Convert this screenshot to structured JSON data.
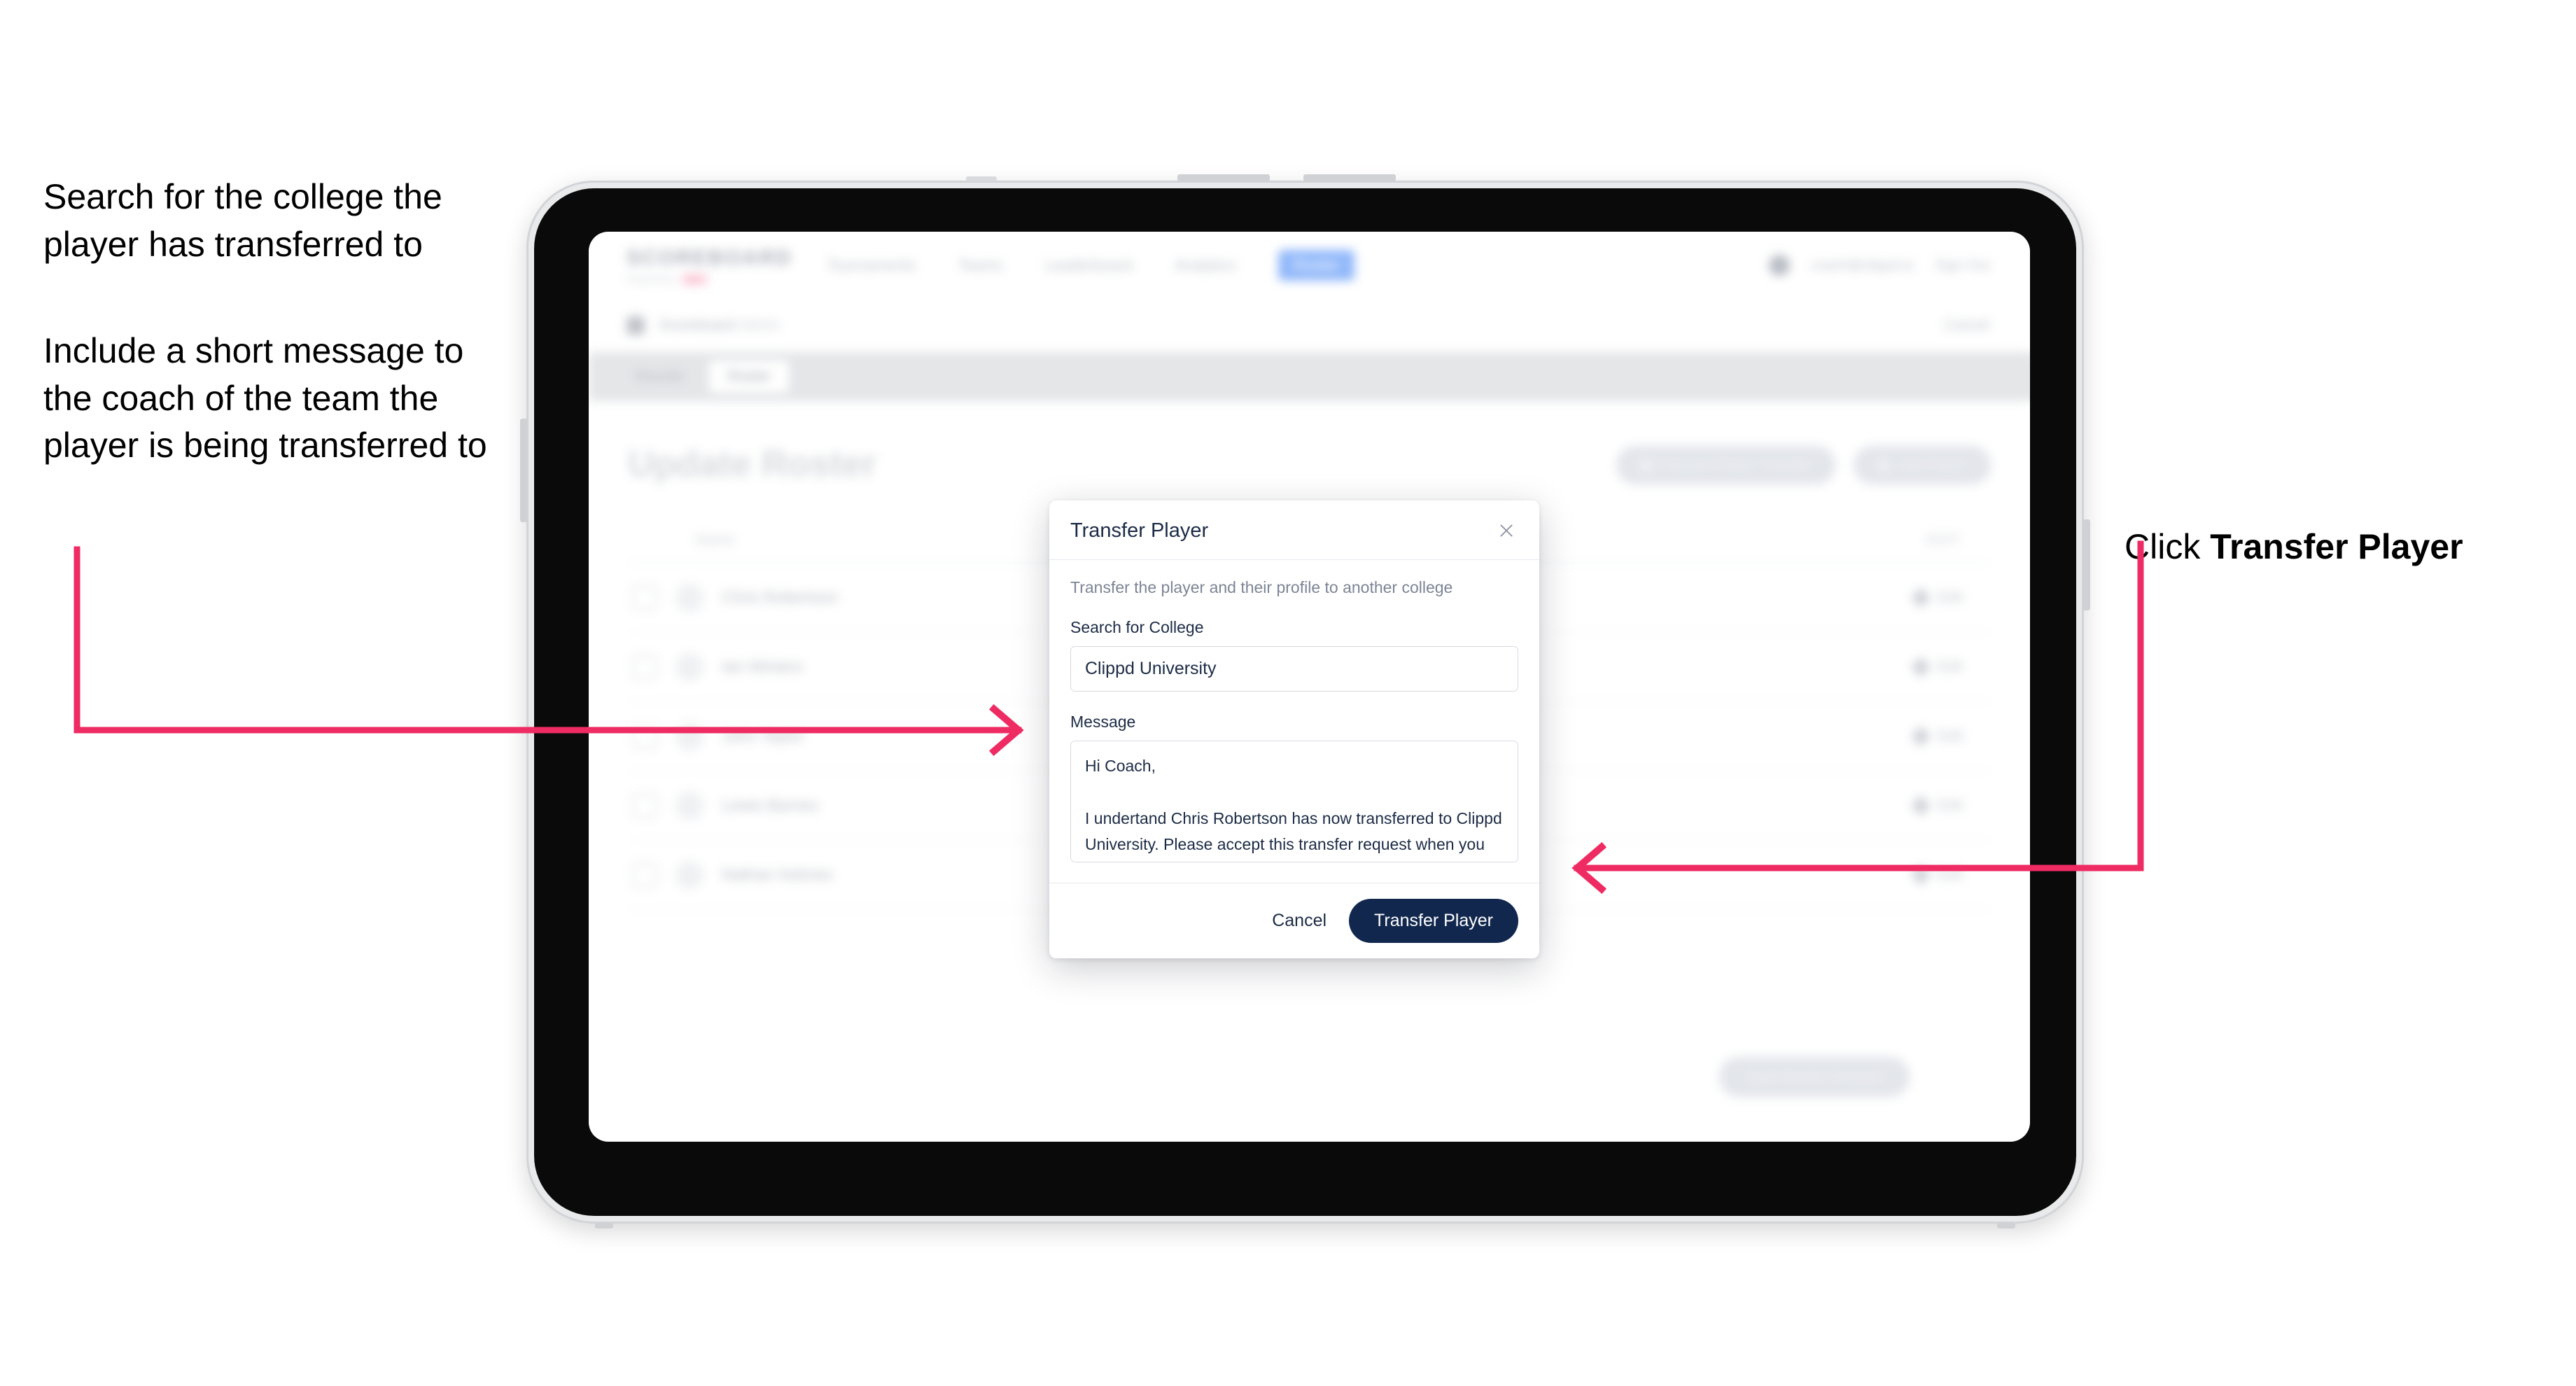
{
  "annotations": {
    "left_note_1": "Search for the college the player has transferred to",
    "left_note_2": "Include a short message to the coach of the team the player is being transferred to",
    "right_note_prefix": "Click ",
    "right_note_bold": "Transfer Player"
  },
  "colors": {
    "arrow": "#ee2b62",
    "primary_button": "#11274d",
    "modal_title": "#1c2b45",
    "nav_pill": "#4f8ef7"
  },
  "app": {
    "logo": "SCOREBOARD",
    "logo_sub": "Powered by",
    "logo_badge": "beta",
    "nav_links": [
      "Tournaments",
      "Teams",
      "Leaderboard",
      "Analytics"
    ],
    "nav_active": "Roster",
    "user_email": "coach@clippd.io",
    "sign_out": "Sign Out",
    "breadcrumb": "Scoreboard",
    "breadcrumb_sub": "Admin",
    "breadcrumb_action": "Cancel",
    "tabs": [
      {
        "label": "Results",
        "active": false
      },
      {
        "label": "Roster",
        "active": true
      }
    ],
    "page_title": "Update Roster",
    "header_buttons": [
      {
        "label": "Request Player Transfer",
        "icon": "transfer-icon"
      },
      {
        "label": "Add Player",
        "icon": "plus-icon"
      }
    ],
    "table": {
      "columns": [
        "Name",
        "EDIT"
      ],
      "rows": [
        {
          "name": "Chris Robertson",
          "action": "Edit"
        },
        {
          "name": "Ian Winters",
          "action": "Edit"
        },
        {
          "name": "John Taylor",
          "action": "Edit"
        },
        {
          "name": "Lewis Barnes",
          "action": "Edit"
        },
        {
          "name": "Nathan Holmes",
          "action": "Edit"
        }
      ]
    },
    "save_button": "Save Roster Changes"
  },
  "modal": {
    "title": "Transfer Player",
    "close_icon": "close-icon",
    "subtitle": "Transfer the player and their profile to another college",
    "college_label": "Search for College",
    "college_value": "Clippd University",
    "college_placeholder": "Search for College",
    "message_label": "Message",
    "message_value": "Hi Coach,\n\nI undertand Chris Robertson has now transferred to Clippd University. Please accept this transfer request when you can.",
    "message_placeholder": "Write a message",
    "cancel_label": "Cancel",
    "submit_label": "Transfer Player"
  }
}
